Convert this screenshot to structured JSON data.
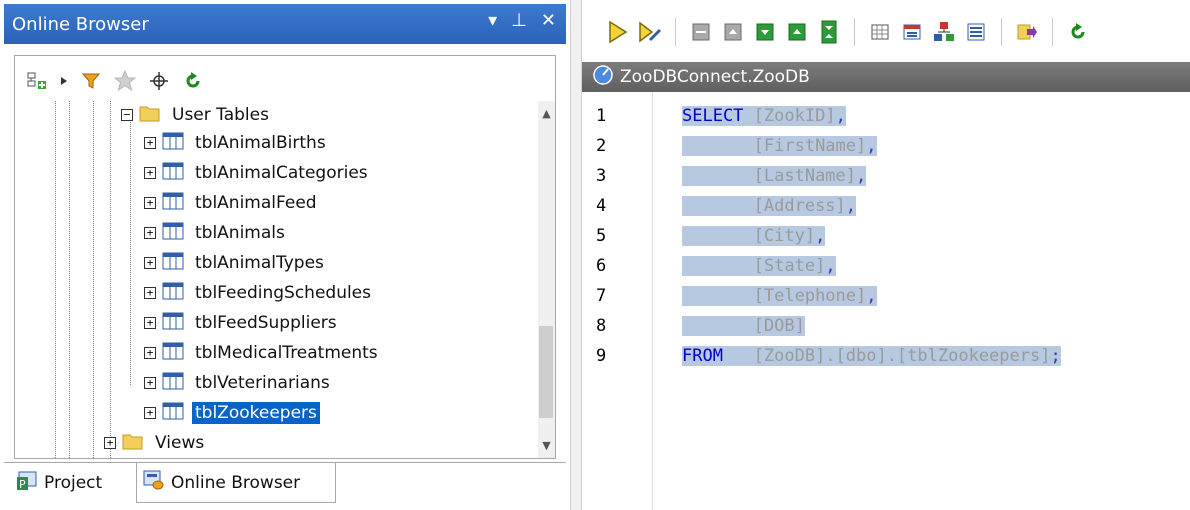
{
  "browser_panel": {
    "title": "Online Browser",
    "controls": [
      "▾",
      "⊥",
      "✕"
    ],
    "toolbar_icons": [
      "add-connection-icon",
      "dropdown-arrow-icon",
      "filter-icon",
      "favorite-star-icon",
      "locate-icon",
      "refresh-icon"
    ],
    "tree": {
      "folder_user_tables": "User Tables",
      "tables": [
        "tblAnimalBirths",
        "tblAnimalCategories",
        "tblAnimalFeed",
        "tblAnimals",
        "tblAnimalTypes",
        "tblFeedingSchedules",
        "tblFeedSuppliers",
        "tblMedicalTreatments",
        "tblVeterinarians",
        "tblZookeepers"
      ],
      "selected_table": "tblZookeepers",
      "folder_views": "Views"
    },
    "tabs": [
      {
        "label": "Project",
        "active": false
      },
      {
        "label": "Online Browser",
        "active": true
      }
    ]
  },
  "editor": {
    "tab_title": "ZooDBConnect.ZooDB",
    "line_numbers": [
      "1",
      "2",
      "3",
      "4",
      "5",
      "6",
      "7",
      "8",
      "9"
    ],
    "lines": [
      {
        "kw": "SELECT",
        "ident": "[ZookID]",
        "punct": ","
      },
      {
        "kw": "",
        "ident": "[FirstName]",
        "punct": ","
      },
      {
        "kw": "",
        "ident": "[LastName]",
        "punct": ","
      },
      {
        "kw": "",
        "ident": "[Address]",
        "punct": ","
      },
      {
        "kw": "",
        "ident": "[City]",
        "punct": ","
      },
      {
        "kw": "",
        "ident": "[State]",
        "punct": ","
      },
      {
        "kw": "",
        "ident": "[Telephone]",
        "punct": ","
      },
      {
        "kw": "",
        "ident": "[DOB]",
        "punct": ""
      },
      {
        "kw": "FROM",
        "ident": "[ZooDB].[dbo].[tblZookeepers]",
        "punct": ";"
      }
    ]
  },
  "colors": {
    "title_bar": "#2b62b8",
    "selection": "#0a64c8",
    "keyword": "#0000cc",
    "identifier": "#9a9a9a",
    "highlight": "#b6c9e1"
  }
}
